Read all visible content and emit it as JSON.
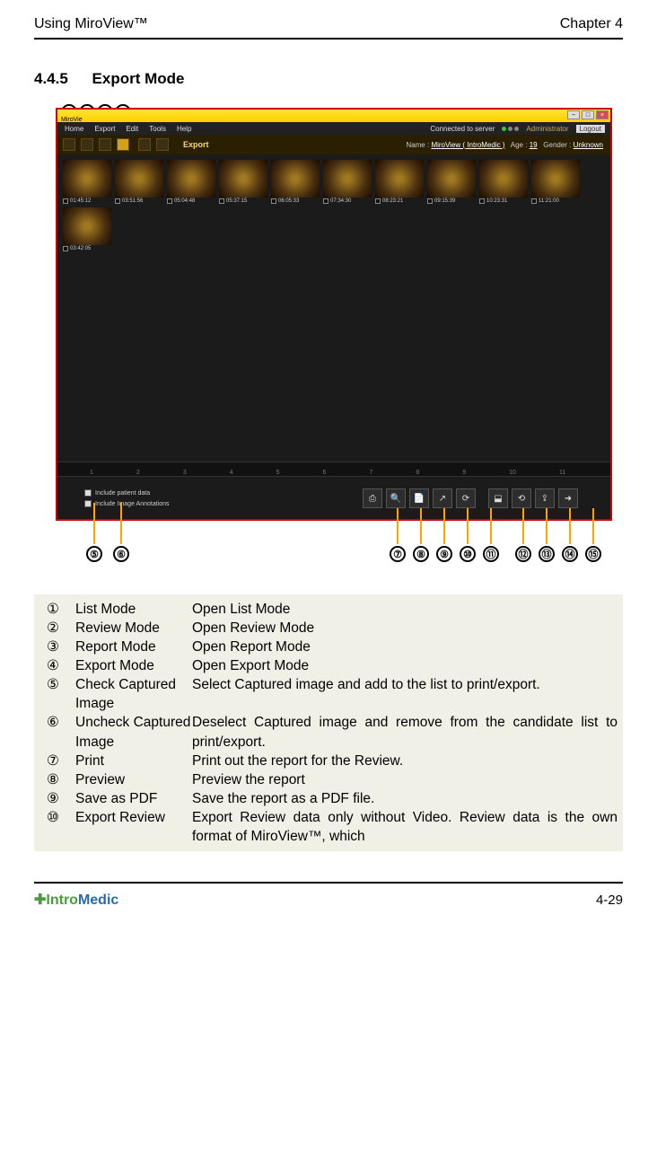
{
  "header": {
    "left": "Using MiroView™",
    "right": "Chapter 4"
  },
  "section": {
    "number": "4.4.5",
    "title": "Export Mode"
  },
  "callouts_top": [
    "①",
    "②",
    "③",
    "④"
  ],
  "callouts_bottom_left": [
    "⑤",
    "⑥"
  ],
  "callouts_bottom_right": [
    "⑦",
    "⑧",
    "⑨",
    "⑩",
    "⑪",
    "⑫",
    "⑬",
    "⑭",
    "⑮"
  ],
  "window": {
    "title_left": "MiroVie",
    "menus": [
      "Home",
      "Export",
      "Edit",
      "Tools",
      "Help"
    ],
    "conn": "Connected to server",
    "role": "Administrator",
    "logout": "Logout",
    "export_label": "Export",
    "info": {
      "name_label": "Name :",
      "name": "MiroView ( IntroMedic )",
      "age_label": "Age :",
      "age": "19",
      "gender_label": "Gender :",
      "gender": "Unknown"
    },
    "thumbs": [
      "01:45:12",
      "03:51:56",
      "05:04:48",
      "05:37:15",
      "06:05:33",
      "07:34:30",
      "08:23:21",
      "09:15:39",
      "10:23:31",
      "11:21:00",
      "03:42:05"
    ],
    "ruler": [
      "1",
      "2",
      "3",
      "4",
      "5",
      "6",
      "7",
      "8",
      "9",
      "10",
      "11"
    ],
    "opt1": "Include patient data",
    "opt2": "Include Image Annotations"
  },
  "desc": [
    {
      "n": "①",
      "label": "List Mode",
      "txt": "Open List Mode"
    },
    {
      "n": "②",
      "label": "Review Mode",
      "txt": "Open Review Mode"
    },
    {
      "n": "③",
      "label": "Report Mode",
      "txt": "Open Report Mode"
    },
    {
      "n": "④",
      "label": "Export Mode",
      "txt": "Open Export Mode"
    },
    {
      "n": "⑤",
      "label": "Check Captured Image",
      "txt": "Select Captured image and add to the list to print/export."
    },
    {
      "n": "⑥",
      "label": "Uncheck Captured Image",
      "txt": "Deselect Captured image and remove from the candidate list to print/export."
    },
    {
      "n": "⑦",
      "label": "Print",
      "txt": "Print out the report for the Review."
    },
    {
      "n": "⑧",
      "label": "Preview",
      "txt": "Preview the report"
    },
    {
      "n": "⑨",
      "label": "Save as PDF",
      "txt": "Save the report as a PDF file."
    },
    {
      "n": "⑩",
      "label": "Export Review",
      "txt": "Export Review data only without Video. Review data is the own format of MiroView™, which"
    }
  ],
  "footer": {
    "logo_pre": "Intro",
    "logo_post": "Medic",
    "page": "4-29"
  }
}
